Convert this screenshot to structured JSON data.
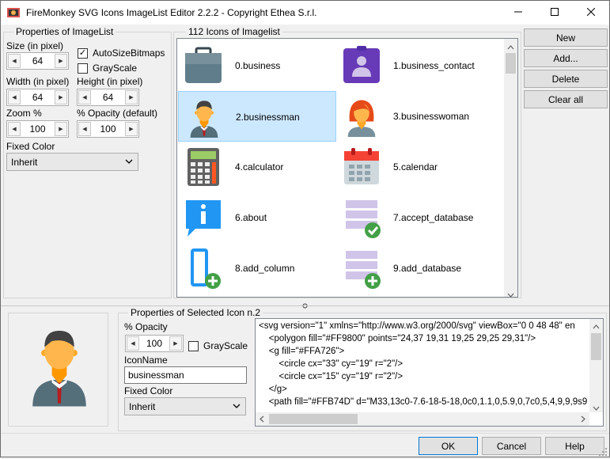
{
  "window": {
    "title": "FireMonkey SVG Icons ImageList Editor 2.2.2 - Copyright Ethea S.r.l."
  },
  "imagelist_props": {
    "legend": "Properties of ImageList",
    "size_label": "Size (in pixel)",
    "size_value": "64",
    "autosize_label": "AutoSizeBitmaps",
    "autosize_checked": true,
    "grayscale_label": "GrayScale",
    "grayscale_checked": false,
    "width_label": "Width (in pixel)",
    "width_value": "64",
    "height_label": "Height (in pixel)",
    "height_value": "64",
    "zoom_label": "Zoom %",
    "zoom_value": "100",
    "opacity_label": "% Opacity (default)",
    "opacity_value": "100",
    "fixedcolor_label": "Fixed Color",
    "fixedcolor_value": "Inherit"
  },
  "icons_panel": {
    "legend": "112 Icons of Imagelist",
    "items": [
      {
        "name": "0.business",
        "icon": "briefcase-icon"
      },
      {
        "name": "1.business_contact",
        "icon": "contact-card-icon"
      },
      {
        "name": "2.businessman",
        "icon": "businessman-icon",
        "selected": true
      },
      {
        "name": "3.businesswoman",
        "icon": "businesswoman-icon"
      },
      {
        "name": "4.calculator",
        "icon": "calculator-icon"
      },
      {
        "name": "5.calendar",
        "icon": "calendar-icon"
      },
      {
        "name": "6.about",
        "icon": "info-bubble-icon"
      },
      {
        "name": "7.accept_database",
        "icon": "accept-database-icon"
      },
      {
        "name": "8.add_column",
        "icon": "add-column-icon"
      },
      {
        "name": "9.add_database",
        "icon": "add-database-icon"
      }
    ]
  },
  "side_buttons": {
    "new": "New",
    "add": "Add...",
    "delete": "Delete",
    "clear": "Clear all"
  },
  "selected_icon": {
    "legend": "Properties of Selected Icon n.2",
    "opacity_label": "% Opacity",
    "opacity_value": "100",
    "grayscale_label": "GrayScale",
    "grayscale_checked": false,
    "iconname_label": "IconName",
    "iconname_value": "businessman",
    "fixedcolor_label": "Fixed Color",
    "fixedcolor_value": "Inherit",
    "svg_lines": [
      "<svg version=\"1\" xmlns=\"http://www.w3.org/2000/svg\" viewBox=\"0 0 48 48\" en",
      "    <polygon fill=\"#FF9800\" points=\"24,37 19,31 19,25 29,25 29,31\"/>",
      "    <g fill=\"#FFA726\">",
      "        <circle cx=\"33\" cy=\"19\" r=\"2\"/>",
      "        <circle cx=\"15\" cy=\"19\" r=\"2\"/>",
      "    </g>",
      "    <path fill=\"#FFB74D\" d=\"M33,13c0-7.6-18-5-18,0c0,1.1,0,5.9,0,7c0,5,4,9,9,9s9"
    ]
  },
  "footer": {
    "ok": "OK",
    "cancel": "Cancel",
    "help": "Help"
  }
}
